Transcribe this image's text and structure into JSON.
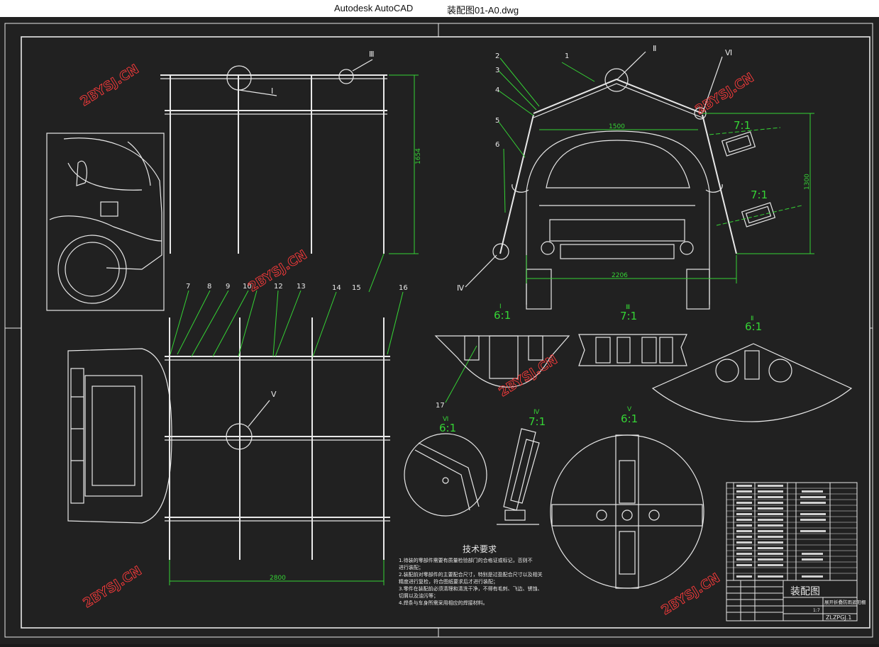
{
  "window": {
    "app_title": "Autodesk AutoCAD",
    "document_title": "装配图01-A0.dwg"
  },
  "drawing": {
    "watermark": "2BYSJ.CN",
    "callouts": [
      "1",
      "2",
      "3",
      "4",
      "5",
      "6",
      "7",
      "8",
      "9",
      "10",
      "12",
      "13",
      "14",
      "15",
      "16",
      "17"
    ],
    "view_markers": [
      "Ⅰ",
      "Ⅱ",
      "Ⅲ",
      "Ⅳ",
      "Ⅴ",
      "Ⅵ"
    ],
    "dimensions": {
      "side_height": "1654",
      "front_top_width": "1500",
      "front_height": "1300",
      "front_base_width": "2206",
      "plan_width": "2800"
    },
    "scales": {
      "section_a": "7:1",
      "section_b": "7:1",
      "detail_I": "6:1",
      "detail_III": "7:1",
      "detail_II": "6:1",
      "detail_VI": "6:1",
      "detail_IV": "7:1",
      "detail_V": "6:1"
    },
    "tech_req": {
      "title": "技术要求",
      "items": [
        "1.待装的零部件需要有质量检验部门的合格证或标记，否则不",
        "进行装配；",
        "2.装配前对零部件的主要配合尺寸，特别是过盈配合尺寸以及相关",
        "精度进行复检，符合图纸要求后才进行装配；",
        "3.零件在装配前必须清理和清洗干净，不得有毛刺、飞边、锈蚀、",
        "切屑以及油污等；",
        "4.焊条与车身所需采用相应的焊接材料。"
      ]
    },
    "title_block": {
      "drawing_name": "装配图",
      "subtitle": "展开折叠防雨遮阳棚",
      "drawing_no": "ZLZPGJ.1",
      "scale_label": "1:7"
    }
  }
}
